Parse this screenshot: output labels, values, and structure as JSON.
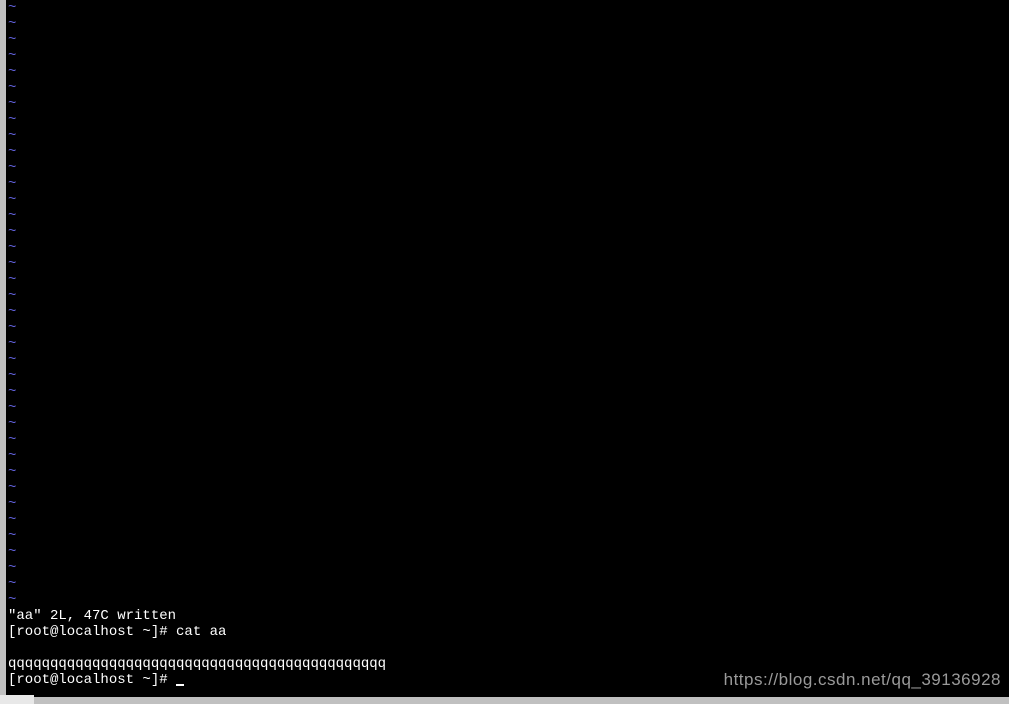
{
  "terminal": {
    "tilde_char": "~",
    "tilde_count": 38,
    "output_lines": [
      "\"aa\" 2L, 47C written",
      "[root@localhost ~]# cat aa",
      "",
      "qqqqqqqqqqqqqqqqqqqqqqqqqqqqqqqqqqqqqqqqqqqqq"
    ],
    "prompt": "[root@localhost ~]# "
  },
  "watermark": "https://blog.csdn.net/qq_39136928"
}
